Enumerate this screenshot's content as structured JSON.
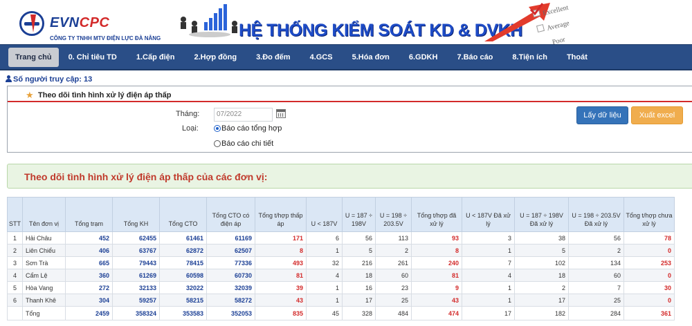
{
  "header": {
    "brand_main": "EVN",
    "brand_accent": "CPC",
    "company": "CÔNG TY TNHH MTV ĐIỆN LỰC ĐÀ NẴNG",
    "system_title": "HỆ THỐNG KIỂM SOÁT KD & DVKH",
    "rating_labels": [
      "Excellent",
      "Average",
      "Poor"
    ]
  },
  "nav": [
    {
      "label": "Trang chủ",
      "active": true
    },
    {
      "label": "0. Chỉ tiêu TD"
    },
    {
      "label": "1.Cấp điện"
    },
    {
      "label": "2.Hợp đồng"
    },
    {
      "label": "3.Đo đếm"
    },
    {
      "label": "4.GCS"
    },
    {
      "label": "5.Hóa đơn"
    },
    {
      "label": "6.GDKH"
    },
    {
      "label": "7.Báo cáo"
    },
    {
      "label": "8.Tiện ích"
    },
    {
      "label": "Thoát"
    }
  ],
  "visitors": "Số người truy cập: 13",
  "filter": {
    "title": "Theo dõi tình hình xử lý điện áp thấp",
    "month_label": "Tháng:",
    "month_value": "07/2022",
    "type_label": "Loại:",
    "radio_summary": "Báo cáo tổng hợp",
    "radio_detail": "Báo cáo chi tiết",
    "btn_get": "Lấy dữ liệu",
    "btn_excel": "Xuất excel"
  },
  "result": {
    "title": "Theo dõi tình hình xử lý điện áp thấp của các đơn vị:"
  },
  "table": {
    "headers": [
      "STT",
      "Tên đơn vị",
      "Tổng trạm",
      "Tổng KH",
      "Tổng CTO",
      "Tổng CTO có điện áp",
      "Tổng t/hợp thấp áp",
      "U < 187V",
      "U = 187 ÷ 198V",
      "U = 198 ÷ 203.5V",
      "Tổng t/hợp đã xử lý",
      "U < 187V Đã xử lý",
      "U = 187 ÷ 198V Đã xử lý",
      "U = 198 ÷ 203.5V Đã xử lý",
      "Tổng t/hợp chưa xử lý"
    ],
    "rows": [
      [
        "1",
        "Hải Châu",
        "452",
        "62455",
        "61461",
        "61169",
        "171",
        "6",
        "56",
        "113",
        "93",
        "3",
        "38",
        "56",
        "78"
      ],
      [
        "2",
        "Liên Chiểu",
        "406",
        "63767",
        "62872",
        "62507",
        "8",
        "1",
        "5",
        "2",
        "8",
        "1",
        "5",
        "2",
        "0"
      ],
      [
        "3",
        "Sơn Trà",
        "665",
        "79443",
        "78415",
        "77336",
        "493",
        "32",
        "216",
        "261",
        "240",
        "7",
        "102",
        "134",
        "253"
      ],
      [
        "4",
        "Cẩm Lệ",
        "360",
        "61269",
        "60598",
        "60730",
        "81",
        "4",
        "18",
        "60",
        "81",
        "4",
        "18",
        "60",
        "0"
      ],
      [
        "5",
        "Hòa Vang",
        "272",
        "32133",
        "32022",
        "32039",
        "39",
        "1",
        "16",
        "23",
        "9",
        "1",
        "2",
        "7",
        "30"
      ],
      [
        "6",
        "Thanh Khê",
        "304",
        "59257",
        "58215",
        "58272",
        "43",
        "1",
        "17",
        "25",
        "43",
        "1",
        "17",
        "25",
        "0"
      ]
    ],
    "total": [
      "",
      "Tổng",
      "2459",
      "358324",
      "353583",
      "352053",
      "835",
      "45",
      "328",
      "484",
      "474",
      "17",
      "182",
      "284",
      "361"
    ]
  }
}
